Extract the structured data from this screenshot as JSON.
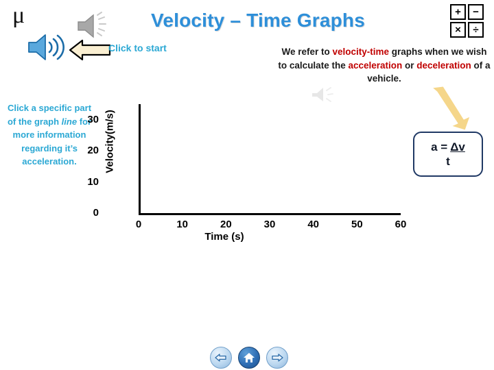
{
  "slide": {
    "title": "Velocity – Time Graphs",
    "mu_symbol": "μ",
    "click_to_start": "Click to start"
  },
  "icons": {
    "speaker_gray": "speaker-muted-icon",
    "speaker_blue": "speaker-icon",
    "speaker_faint": "speaker-faint-icon",
    "arrow_left": "arrow-left-icon",
    "arrow_yellow": "arrow-diagonal-icon"
  },
  "operators": {
    "plus": "+",
    "minus": "−",
    "times": "×",
    "divide": "÷"
  },
  "intro": {
    "part1": "We refer to ",
    "hl1": "velocity-time",
    "part2": " graphs when we wish to calculate the ",
    "hl2": "acceleration",
    "part3": " or ",
    "hl3": "deceleration",
    "part4": " of a vehicle."
  },
  "instruction": {
    "part1": "Click a specific part of the graph ",
    "italic": "line",
    "part2": " for more information regarding it’s acceleration."
  },
  "formula": {
    "lhs": "a =",
    "numerator": "Δv",
    "denominator": "t"
  },
  "nav": {
    "back": "◀",
    "home": "⌂",
    "forward": "▶"
  },
  "colors": {
    "title_blue": "#2E8FD9",
    "cyan": "#2BA8D4",
    "highlight_red": "#C00000",
    "formula_border": "#1F3864"
  },
  "chart_data": {
    "type": "line",
    "title": "",
    "xlabel": "Time (s)",
    "ylabel": "Velocity(m/s)",
    "xlim": [
      0,
      60
    ],
    "ylim": [
      0,
      35
    ],
    "xticks": [
      0,
      10,
      20,
      30,
      40,
      50,
      60
    ],
    "yticks": [
      0,
      10,
      20,
      30
    ],
    "grid": false,
    "legend": null,
    "series": [
      {
        "name": "velocity",
        "x": [],
        "y": []
      }
    ]
  }
}
